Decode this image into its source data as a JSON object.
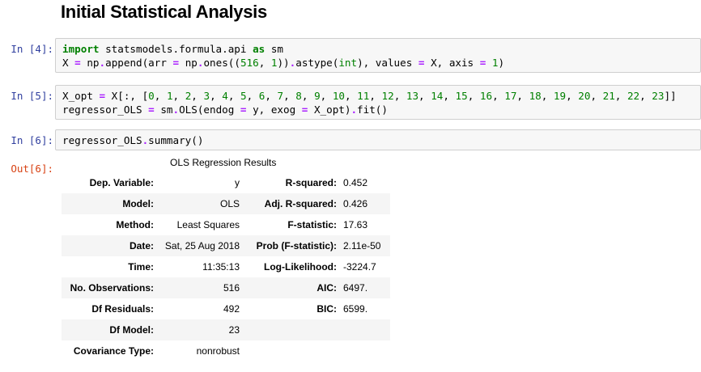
{
  "heading": "Initial Statistical Analysis",
  "cells": [
    {
      "prompt": "In [4]:",
      "lines": [
        [
          [
            "kw",
            "import"
          ],
          [
            "t",
            " statsmodels.formula.api "
          ],
          [
            "kw",
            "as"
          ],
          [
            "t",
            " sm"
          ]
        ],
        [
          [
            "t",
            "X "
          ],
          [
            "op",
            "="
          ],
          [
            "t",
            " np"
          ],
          [
            "op",
            "."
          ],
          [
            "t",
            "append(arr "
          ],
          [
            "op",
            "="
          ],
          [
            "t",
            " np"
          ],
          [
            "op",
            "."
          ],
          [
            "t",
            "ones(("
          ],
          [
            "num",
            "516"
          ],
          [
            "t",
            ", "
          ],
          [
            "num",
            "1"
          ],
          [
            "t",
            "))"
          ],
          [
            "op",
            "."
          ],
          [
            "t",
            "astype("
          ],
          [
            "bi",
            "int"
          ],
          [
            "t",
            "), values "
          ],
          [
            "op",
            "="
          ],
          [
            "t",
            " X, axis "
          ],
          [
            "op",
            "="
          ],
          [
            "t",
            " "
          ],
          [
            "num",
            "1"
          ],
          [
            "t",
            ")"
          ]
        ]
      ]
    },
    {
      "prompt": "In [5]:",
      "lines": [
        [
          [
            "t",
            "X_opt "
          ],
          [
            "op",
            "="
          ],
          [
            "t",
            " X[:, ["
          ],
          [
            "num",
            "0"
          ],
          [
            "t",
            ", "
          ],
          [
            "num",
            "1"
          ],
          [
            "t",
            ", "
          ],
          [
            "num",
            "2"
          ],
          [
            "t",
            ", "
          ],
          [
            "num",
            "3"
          ],
          [
            "t",
            ", "
          ],
          [
            "num",
            "4"
          ],
          [
            "t",
            ", "
          ],
          [
            "num",
            "5"
          ],
          [
            "t",
            ", "
          ],
          [
            "num",
            "6"
          ],
          [
            "t",
            ", "
          ],
          [
            "num",
            "7"
          ],
          [
            "t",
            ", "
          ],
          [
            "num",
            "8"
          ],
          [
            "t",
            ", "
          ],
          [
            "num",
            "9"
          ],
          [
            "t",
            ", "
          ],
          [
            "num",
            "10"
          ],
          [
            "t",
            ", "
          ],
          [
            "num",
            "11"
          ],
          [
            "t",
            ", "
          ],
          [
            "num",
            "12"
          ],
          [
            "t",
            ", "
          ],
          [
            "num",
            "13"
          ],
          [
            "t",
            ", "
          ],
          [
            "num",
            "14"
          ],
          [
            "t",
            ", "
          ],
          [
            "num",
            "15"
          ],
          [
            "t",
            ", "
          ],
          [
            "num",
            "16"
          ],
          [
            "t",
            ", "
          ],
          [
            "num",
            "17"
          ],
          [
            "t",
            ", "
          ],
          [
            "num",
            "18"
          ],
          [
            "t",
            ", "
          ],
          [
            "num",
            "19"
          ],
          [
            "t",
            ", "
          ],
          [
            "num",
            "20"
          ],
          [
            "t",
            ", "
          ],
          [
            "num",
            "21"
          ],
          [
            "t",
            ", "
          ],
          [
            "num",
            "22"
          ],
          [
            "t",
            ", "
          ],
          [
            "num",
            "23"
          ],
          [
            "t",
            "]]"
          ]
        ],
        [
          [
            "t",
            "regressor_OLS "
          ],
          [
            "op",
            "="
          ],
          [
            "t",
            " sm"
          ],
          [
            "op",
            "."
          ],
          [
            "t",
            "OLS(endog "
          ],
          [
            "op",
            "="
          ],
          [
            "t",
            " y, exog "
          ],
          [
            "op",
            "="
          ],
          [
            "t",
            " X_opt)"
          ],
          [
            "op",
            "."
          ],
          [
            "t",
            "fit()"
          ]
        ]
      ]
    },
    {
      "prompt": "In [6]:",
      "lines": [
        [
          [
            "t",
            "regressor_OLS"
          ],
          [
            "op",
            "."
          ],
          [
            "t",
            "summary()"
          ]
        ]
      ]
    }
  ],
  "output": {
    "prompt": "Out[6]:",
    "caption": "OLS Regression Results",
    "rows": [
      {
        "label1": "Dep. Variable:",
        "value1": "y",
        "label2": "R-squared:",
        "value2": "0.452"
      },
      {
        "label1": "Model:",
        "value1": "OLS",
        "label2": "Adj. R-squared:",
        "value2": "0.426"
      },
      {
        "label1": "Method:",
        "value1": "Least Squares",
        "label2": "F-statistic:",
        "value2": "17.63"
      },
      {
        "label1": "Date:",
        "value1": "Sat, 25 Aug 2018",
        "label2": "Prob (F-statistic):",
        "value2": "2.11e-50"
      },
      {
        "label1": "Time:",
        "value1": "11:35:13",
        "label2": "Log-Likelihood:",
        "value2": "-3224.7"
      },
      {
        "label1": "No. Observations:",
        "value1": "516",
        "label2": "AIC:",
        "value2": "6497."
      },
      {
        "label1": "Df Residuals:",
        "value1": "492",
        "label2": "BIC:",
        "value2": "6599."
      },
      {
        "label1": "Df Model:",
        "value1": "23",
        "label2": "",
        "value2": ""
      },
      {
        "label1": "Covariance Type:",
        "value1": "nonrobust",
        "label2": "",
        "value2": ""
      }
    ]
  },
  "colors": {
    "in_prompt": "#303f9f",
    "out_prompt": "#d84315",
    "keyword": "#008000",
    "operator": "#aa22ff",
    "cell_bg": "#f7f7f7"
  }
}
